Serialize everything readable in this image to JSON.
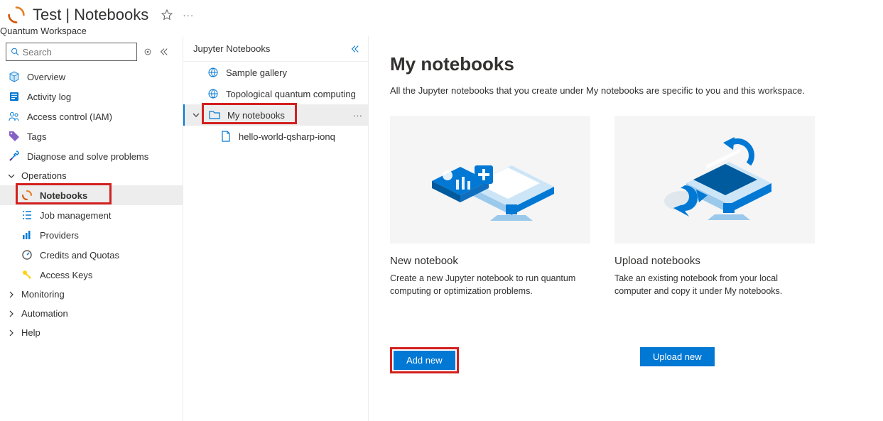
{
  "header": {
    "resource_name": "Test",
    "page_name": "Notebooks",
    "subtitle": "Quantum Workspace"
  },
  "search": {
    "placeholder": "Search"
  },
  "sidebar": {
    "items": [
      {
        "label": "Overview"
      },
      {
        "label": "Activity log"
      },
      {
        "label": "Access control (IAM)"
      },
      {
        "label": "Tags"
      },
      {
        "label": "Diagnose and solve problems"
      }
    ],
    "group_operations": "Operations",
    "ops": [
      {
        "label": "Notebooks"
      },
      {
        "label": "Job management"
      },
      {
        "label": "Providers"
      },
      {
        "label": "Credits and Quotas"
      },
      {
        "label": "Access Keys"
      }
    ],
    "group_monitoring": "Monitoring",
    "group_automation": "Automation",
    "group_help": "Help"
  },
  "tree": {
    "header": "Jupyter Notebooks",
    "items": [
      {
        "label": "Sample gallery"
      },
      {
        "label": "Topological quantum computing"
      },
      {
        "label": "My notebooks"
      }
    ],
    "file": "hello-world-qsharp-ionq"
  },
  "main": {
    "title": "My notebooks",
    "desc": "All the Jupyter notebooks that you create under My notebooks are specific to you and this workspace.",
    "card1": {
      "title": "New notebook",
      "desc": "Create a new Jupyter notebook to run quantum computing or optimization problems.",
      "button": "Add new"
    },
    "card2": {
      "title": "Upload notebooks",
      "desc": "Take an existing notebook from your local computer and copy it under My notebooks.",
      "button": "Upload new"
    }
  }
}
